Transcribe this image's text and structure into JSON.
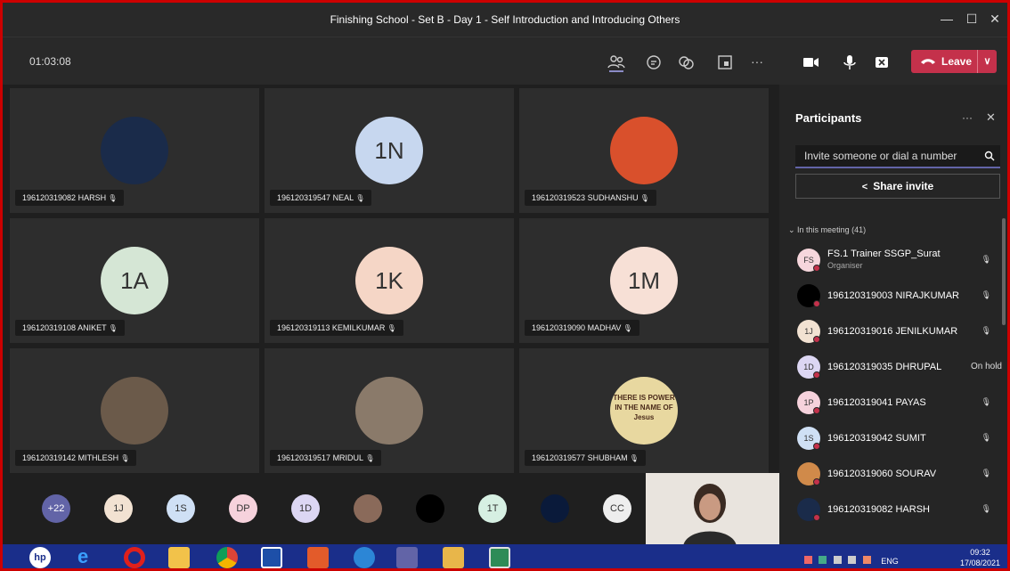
{
  "window": {
    "title": "Finishing School - Set B - Day 1 - Self Introduction and Introducing Others"
  },
  "meeting": {
    "timer": "01:03:08",
    "leave_label": "Leave"
  },
  "tiles": [
    {
      "name": "196120319082 HARSH",
      "initials": "",
      "bg": "#1a2b4a"
    },
    {
      "name": "196120319547 NEAL",
      "initials": "1N",
      "bg": "#c7d7ef"
    },
    {
      "name": "196120319523 SUDHANSHU",
      "initials": "",
      "bg": "#d9502c"
    },
    {
      "name": "196120319108 ANIKET",
      "initials": "1A",
      "bg": "#d5e6d5"
    },
    {
      "name": "196120319113 KEMILKUMAR",
      "initials": "1K",
      "bg": "#f5d6c6"
    },
    {
      "name": "196120319090 MADHAV",
      "initials": "1M",
      "bg": "#f7e0d6"
    },
    {
      "name": "196120319142 MITHLESH",
      "initials": "",
      "bg": "#6b5a4a"
    },
    {
      "name": "196120319517 MRIDUL",
      "initials": "",
      "bg": "#8a7a6a"
    },
    {
      "name": "196120319577 SHUBHAM",
      "initials": "THERE IS POWER IN THE NAME OF Jesus",
      "bg": "#e8d8a0"
    }
  ],
  "strip": [
    {
      "label": "+22",
      "bg": "#6264a7"
    },
    {
      "label": "1J",
      "bg": "#f2e2d2"
    },
    {
      "label": "1S",
      "bg": "#cfe0f5"
    },
    {
      "label": "DP",
      "bg": "#f6d2dc"
    },
    {
      "label": "1D",
      "bg": "#dcd6f3"
    },
    {
      "label": "",
      "bg": "#8a6a5a"
    },
    {
      "label": "",
      "bg": "#000000"
    },
    {
      "label": "1T",
      "bg": "#d6efe2"
    },
    {
      "label": "",
      "bg": "#0a1a3a"
    },
    {
      "label": "CC",
      "bg": "#eeeeee"
    }
  ],
  "panel": {
    "title": "Participants",
    "invite_placeholder": "Invite someone or dial a number",
    "share_label": "Share invite",
    "in_meeting": "In this meeting (41)",
    "people": [
      {
        "initials": "FS",
        "name": "FS.1 Trainer SSGP_Surat",
        "sub": "Organiser",
        "status": "",
        "bg": "#f6d6dc"
      },
      {
        "initials": "",
        "name": "196120319003 NIRAJKUMAR",
        "sub": "",
        "status": "",
        "bg": "#000000"
      },
      {
        "initials": "1J",
        "name": "196120319016 JENILKUMAR",
        "sub": "",
        "status": "",
        "bg": "#f2e2d2"
      },
      {
        "initials": "1D",
        "name": "196120319035 DHRUPAL",
        "sub": "",
        "status": "On hold",
        "bg": "#dcd6f3"
      },
      {
        "initials": "1P",
        "name": "196120319041 PAYAS",
        "sub": "",
        "status": "",
        "bg": "#f6d2dc"
      },
      {
        "initials": "1S",
        "name": "196120319042 SUMIT",
        "sub": "",
        "status": "",
        "bg": "#cfe0f5"
      },
      {
        "initials": "",
        "name": "196120319060 SOURAV",
        "sub": "",
        "status": "",
        "bg": "#d08a4a"
      },
      {
        "initials": "",
        "name": "196120319082 HARSH",
        "sub": "",
        "status": "",
        "bg": "#1a2b4a"
      }
    ]
  },
  "taskbar": {
    "lang": "ENG",
    "time": "09:32",
    "date": "17/08/2021"
  }
}
